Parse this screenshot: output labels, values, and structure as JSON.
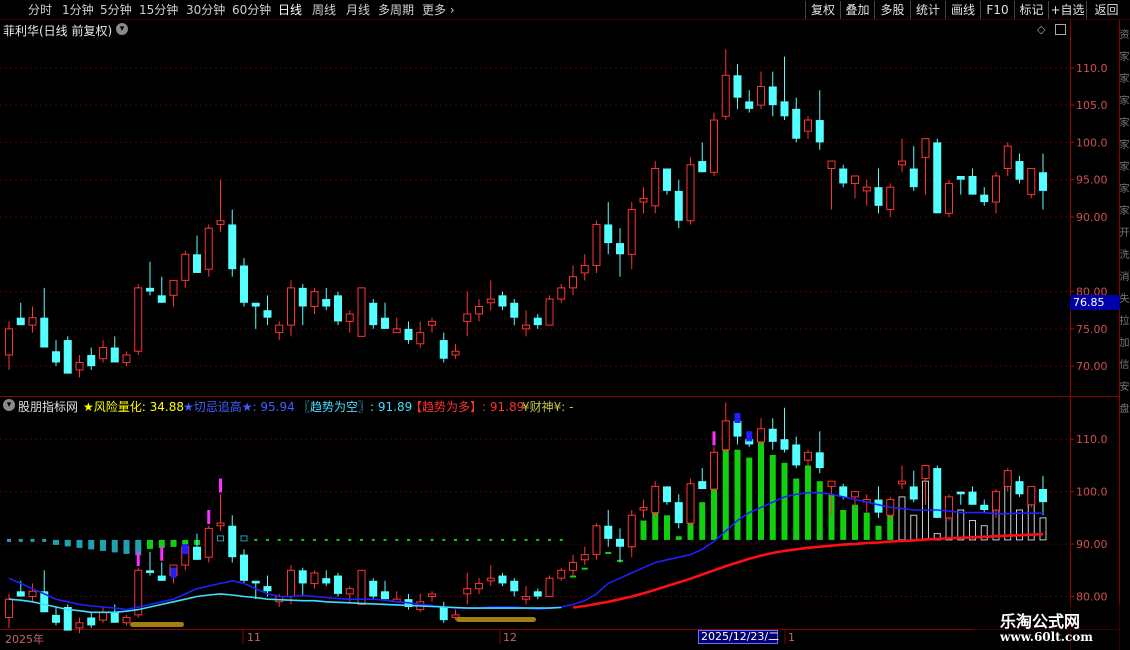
{
  "toolbar": {
    "periods": [
      "分时",
      "1分钟",
      "5分钟",
      "15分钟",
      "30分钟",
      "60分钟",
      "日线",
      "周线",
      "月线",
      "多周期",
      "更多"
    ],
    "active_period": "日线",
    "right_buttons": [
      "复权",
      "叠加",
      "多股",
      "统计",
      "画线",
      "F10",
      "标记",
      "+自选",
      "返回"
    ]
  },
  "main_chart": {
    "title": "菲利华(日线 前复权)",
    "price_tag": "76.85",
    "axis_ticks": [
      "110.0",
      "105.0",
      "100.0",
      "95.00",
      "90.00",
      "80.00",
      "75.00",
      "70.00"
    ]
  },
  "sub_chart": {
    "title": "股朋指标网",
    "indicators": [
      {
        "label": "★风险量化:",
        "value": "34.88",
        "color": "#ffff00"
      },
      {
        "label": "★切忌追高★:",
        "value": "95.94",
        "color": "#4060ff"
      },
      {
        "label": "〖趋势为空〗:",
        "value": "91.89",
        "color": "#40e0ff"
      },
      {
        "label": "【趋势为多】:",
        "value": "91.89",
        "color": "#ff3030"
      },
      {
        "label": "¥财神¥:",
        "value": "-",
        "color": "#c8c840"
      }
    ],
    "axis_ticks": [
      "110.0",
      "100.0",
      "90.00",
      "80.00"
    ]
  },
  "right_strip": [
    "资",
    "家",
    "家",
    "家",
    "家",
    "家",
    "家",
    "家",
    "家",
    "开",
    "洗",
    "消",
    "失",
    "拉",
    "加",
    "信",
    "安",
    "盘"
  ],
  "dates": {
    "labels": [
      "2025年",
      "11",
      "12",
      "1"
    ],
    "cursor": "2025/12/23/二"
  },
  "watermark": {
    "line1": "乐淘公式网",
    "line2": "www.60lt.com"
  },
  "colors": {
    "up": "#ff3333",
    "down": "#54ffff",
    "grid": "#500000",
    "ma_blue": "#2020ff",
    "ma_cyan": "#40e0ff",
    "ma_red": "#ff1010",
    "bar_green": "#10d010",
    "bar_teal": "#20a0b0",
    "marker_magenta": "#ff30ff",
    "marker_gold": "#a08010"
  },
  "chart_data": [
    {
      "type": "candlestick",
      "title": "菲利华(日线 前复权)",
      "ylim": [
        66,
        114
      ],
      "ohlc": [
        [
          71.5,
          76.0,
          69.5,
          75.0
        ],
        [
          76.5,
          78.5,
          75.5,
          75.5
        ],
        [
          75.5,
          78.0,
          74.5,
          76.5
        ],
        [
          76.5,
          80.5,
          73.0,
          72.5
        ],
        [
          72.0,
          73.5,
          70.0,
          70.5
        ],
        [
          73.5,
          74.0,
          69.0,
          69.0
        ],
        [
          69.5,
          71.5,
          68.5,
          70.5
        ],
        [
          71.5,
          72.5,
          69.5,
          70.0
        ],
        [
          71.0,
          73.5,
          70.5,
          72.5
        ],
        [
          72.5,
          74.0,
          71.0,
          70.5
        ],
        [
          70.5,
          72.0,
          70.0,
          71.5
        ],
        [
          72.0,
          81.0,
          71.5,
          80.5
        ],
        [
          80.5,
          84.0,
          79.5,
          80.0
        ],
        [
          79.5,
          82.0,
          78.5,
          78.5
        ],
        [
          79.5,
          81.0,
          78.0,
          81.5
        ],
        [
          81.5,
          85.5,
          80.5,
          85.0
        ],
        [
          85.0,
          87.5,
          82.5,
          82.5
        ],
        [
          83.0,
          89.0,
          82.0,
          88.5
        ],
        [
          89.0,
          95.0,
          88.0,
          89.5
        ],
        [
          89.0,
          91.0,
          82.0,
          83.0
        ],
        [
          83.5,
          84.5,
          78.0,
          78.5
        ],
        [
          78.5,
          78.5,
          75.0,
          78.0
        ],
        [
          77.5,
          79.5,
          75.5,
          76.5
        ],
        [
          74.5,
          76.0,
          73.5,
          75.5
        ],
        [
          75.5,
          81.5,
          74.0,
          80.5
        ],
        [
          80.5,
          81.0,
          75.5,
          78.0
        ],
        [
          78.0,
          80.5,
          77.0,
          80.0
        ],
        [
          79.0,
          80.5,
          77.5,
          78.0
        ],
        [
          79.5,
          80.0,
          75.5,
          76.0
        ],
        [
          76.0,
          77.5,
          74.5,
          77.0
        ],
        [
          74.0,
          80.5,
          74.0,
          80.5
        ],
        [
          78.5,
          79.0,
          75.0,
          75.5
        ],
        [
          76.5,
          78.5,
          75.0,
          75.0
        ],
        [
          74.5,
          76.5,
          74.5,
          75.0
        ],
        [
          75.0,
          76.0,
          73.0,
          73.5
        ],
        [
          73.0,
          76.0,
          72.5,
          74.5
        ],
        [
          75.5,
          76.5,
          74.5,
          76.0
        ],
        [
          73.5,
          74.5,
          70.5,
          71.0
        ],
        [
          71.5,
          73.0,
          71.0,
          72.0
        ],
        [
          76.0,
          80.0,
          74.0,
          77.0
        ],
        [
          77.0,
          79.0,
          76.0,
          78.0
        ],
        [
          78.5,
          81.5,
          77.5,
          79.0
        ],
        [
          79.5,
          80.0,
          77.5,
          78.0
        ],
        [
          78.5,
          79.0,
          75.5,
          76.5
        ],
        [
          75.0,
          77.5,
          74.0,
          75.5
        ],
        [
          76.5,
          77.0,
          75.0,
          75.5
        ],
        [
          75.5,
          79.5,
          75.5,
          79.0
        ],
        [
          79.0,
          81.0,
          78.5,
          80.5
        ],
        [
          80.5,
          83.5,
          79.5,
          82.0
        ],
        [
          82.5,
          85.0,
          81.5,
          83.5
        ],
        [
          83.5,
          89.5,
          82.5,
          89.0
        ],
        [
          89.0,
          92.0,
          85.0,
          86.5
        ],
        [
          86.5,
          88.5,
          82.0,
          85.0
        ],
        [
          85.0,
          92.0,
          83.0,
          91.0
        ],
        [
          92.0,
          94.0,
          90.5,
          92.5
        ],
        [
          91.5,
          97.5,
          90.5,
          96.5
        ],
        [
          96.5,
          96.5,
          93.0,
          93.5
        ],
        [
          93.5,
          95.0,
          88.5,
          89.5
        ],
        [
          89.5,
          98.0,
          89.0,
          97.0
        ],
        [
          97.5,
          100.0,
          96.0,
          96.0
        ],
        [
          96.0,
          104.0,
          95.5,
          103.0
        ],
        [
          103.5,
          112.5,
          103.0,
          109.0
        ],
        [
          109.0,
          110.5,
          104.5,
          106.0
        ],
        [
          105.5,
          107.0,
          104.0,
          104.5
        ],
        [
          105.0,
          109.5,
          104.5,
          107.5
        ],
        [
          107.5,
          109.5,
          103.5,
          105.0
        ],
        [
          105.5,
          111.5,
          103.0,
          103.5
        ],
        [
          104.5,
          106.0,
          100.0,
          100.5
        ],
        [
          101.5,
          103.5,
          100.5,
          103.0
        ],
        [
          103.0,
          107.0,
          99.0,
          100.0
        ],
        [
          96.5,
          97.5,
          91.0,
          97.5
        ],
        [
          96.5,
          97.0,
          94.0,
          94.5
        ],
        [
          94.5,
          95.0,
          92.5,
          95.5
        ],
        [
          93.5,
          95.0,
          91.5,
          94.0
        ],
        [
          94.0,
          96.5,
          90.5,
          91.5
        ],
        [
          91.0,
          94.5,
          90.0,
          94.0
        ],
        [
          97.0,
          100.5,
          96.0,
          97.5
        ],
        [
          96.5,
          99.5,
          93.5,
          94.0
        ],
        [
          98.0,
          100.5,
          93.0,
          100.5
        ],
        [
          100.0,
          100.5,
          90.5,
          90.5
        ],
        [
          90.5,
          95.0,
          90.0,
          94.5
        ],
        [
          95.5,
          95.5,
          93.0,
          95.0
        ],
        [
          95.5,
          96.5,
          93.0,
          93.0
        ],
        [
          93.0,
          94.0,
          91.5,
          92.0
        ],
        [
          92.0,
          96.0,
          90.5,
          95.5
        ],
        [
          96.5,
          100.0,
          95.5,
          99.5
        ],
        [
          97.5,
          98.5,
          94.5,
          95.0
        ],
        [
          93.0,
          95.5,
          92.5,
          96.5
        ],
        [
          96.0,
          98.5,
          91.0,
          93.5
        ]
      ]
    },
    {
      "type": "mixed",
      "title": "股朋指标网",
      "ylim": [
        74,
        115
      ],
      "series": [
        {
          "name": "切忌追高",
          "values": [
            83.5,
            82.5,
            81.5,
            80.5,
            79.5,
            79.0,
            78.5,
            78.2,
            78.0,
            77.8,
            77.5,
            78.0,
            78.5,
            79.0,
            79.5,
            80.5,
            81.5,
            82.0,
            82.5,
            83.0,
            82.5,
            81.5,
            80.5,
            80.0,
            80.0,
            80.2,
            80.0,
            79.8,
            79.6,
            79.5,
            79.5,
            79.5,
            79.3,
            79.0,
            78.8,
            78.5,
            78.3,
            78.0,
            77.8,
            77.8,
            77.8,
            78.0,
            78.0,
            78.0,
            77.8,
            77.6,
            77.8,
            78.0,
            78.5,
            79.2,
            80.5,
            82.5,
            83.5,
            84.5,
            85.5,
            86.5,
            87.0,
            87.5,
            88.0,
            89.0,
            90.5,
            92.5,
            94.5,
            96.0,
            97.0,
            98.0,
            99.0,
            99.5,
            99.8,
            99.8,
            99.5,
            99.0,
            98.5,
            98.0,
            97.5,
            97.0,
            96.8,
            96.5,
            96.5,
            96.5,
            96.3,
            96.0,
            96.0,
            96.0,
            95.8,
            95.8,
            95.9,
            95.9,
            95.9
          ]
        },
        {
          "name": "趋势为空",
          "values": [
            79.5,
            79.3,
            79.0,
            78.5,
            78.0,
            77.5,
            77.3,
            77.0,
            77.0,
            77.0,
            77.2,
            77.5,
            78.0,
            78.5,
            79.0,
            79.5,
            80.0,
            80.3,
            80.5,
            80.3,
            80.0,
            79.8,
            79.5,
            79.4,
            79.3,
            79.2,
            79.2,
            79.0,
            78.9,
            78.8,
            78.7,
            78.6,
            78.5,
            78.4,
            78.3,
            78.2,
            78.1,
            78.0,
            77.9,
            77.8,
            77.8,
            77.8,
            77.8,
            77.8,
            77.8,
            77.8,
            77.8,
            77.9
          ]
        },
        {
          "name": "趋势为多",
          "values": [
            77.9,
            78.2,
            78.6,
            79.0,
            79.5,
            80.0,
            80.6,
            81.3,
            82.0,
            82.7,
            83.4,
            84.2,
            85.0,
            85.8,
            86.5,
            87.2,
            87.8,
            88.3,
            88.7,
            89.0,
            89.3,
            89.5,
            89.7,
            89.9,
            90.0,
            90.2,
            90.3,
            90.5,
            90.6,
            90.7,
            90.9,
            91.0,
            91.1,
            91.2,
            91.3,
            91.4,
            91.5,
            91.6,
            91.7,
            91.8,
            91.89
          ]
        }
      ]
    }
  ]
}
